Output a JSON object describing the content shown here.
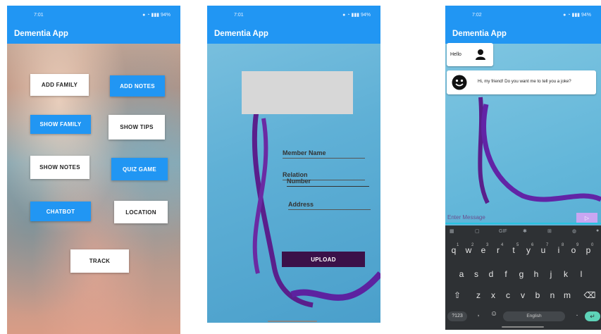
{
  "screen1": {
    "time": "7:01",
    "battery": "94%",
    "title": "Dementia App",
    "buttons": {
      "add_family": "ADD FAMILY",
      "add_notes": "ADD NOTES",
      "show_family": "SHOW FAMILY",
      "show_tips": "SHOW TIPS",
      "show_notes": "SHOW NOTES",
      "quiz_game": "QUIZ GAME",
      "chatbot": "CHATBOT",
      "location": "LOCATION",
      "track": "TRACK"
    }
  },
  "screen2": {
    "time": "7:01",
    "battery": "94%",
    "title": "Dementia App",
    "fields": {
      "member_name": "Member Name",
      "relation": "Relation",
      "number": "Number",
      "address": "Address"
    },
    "upload": "UPLOAD"
  },
  "screen3": {
    "time": "7:02",
    "battery": "94%",
    "title": "Dementia App",
    "messages": {
      "user": "Hello",
      "bot": "Hi, my friend! Do you want me to tell you a joke?"
    },
    "input_placeholder": "Enter Message",
    "keyboard": {
      "gif": "GIF",
      "row1": [
        "q",
        "w",
        "e",
        "r",
        "t",
        "y",
        "u",
        "i",
        "o",
        "p"
      ],
      "row1_sup": [
        "1",
        "2",
        "3",
        "4",
        "5",
        "6",
        "7",
        "8",
        "9",
        "0"
      ],
      "row2": [
        "a",
        "s",
        "d",
        "f",
        "g",
        "h",
        "j",
        "k",
        "l"
      ],
      "row3": [
        "z",
        "x",
        "c",
        "v",
        "b",
        "n",
        "m"
      ],
      "sym": "?123",
      "comma": ",",
      "space": "English",
      "period": "."
    }
  },
  "colors": {
    "app_blue": "#2196f3",
    "upload_purple": "#3b1149",
    "keyboard_bg": "#2e3134",
    "send_purple": "#c9a6f2"
  }
}
